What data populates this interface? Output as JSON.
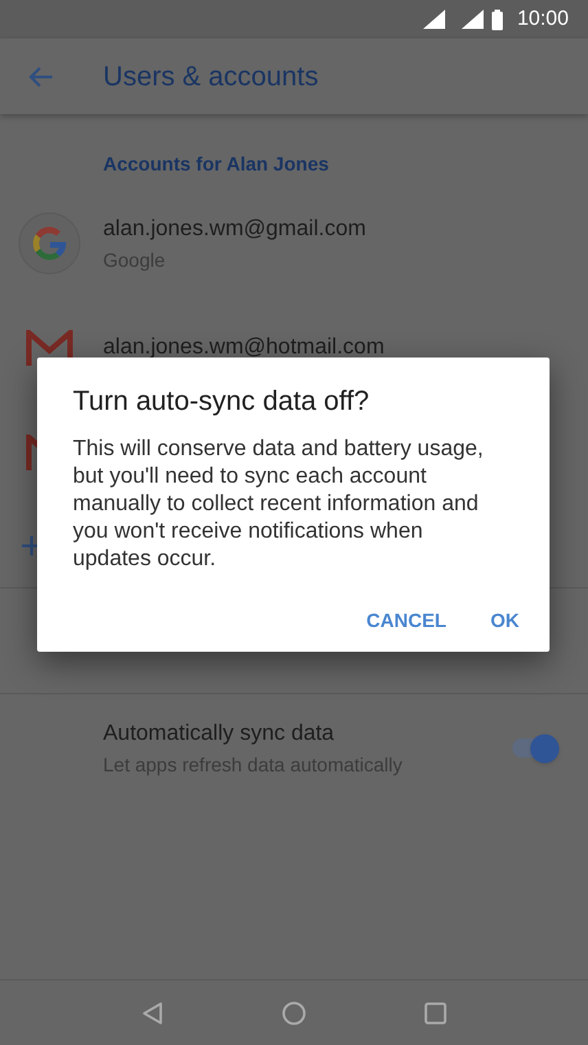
{
  "status_bar": {
    "time": "10:00"
  },
  "app_bar": {
    "title": "Users & accounts"
  },
  "section_header": "Accounts for Alan Jones",
  "accounts": [
    {
      "kind": "google",
      "email": "alan.jones.wm@gmail.com",
      "type": "Google"
    },
    {
      "kind": "mail",
      "email": "alan.jones.wm@hotmail.com"
    },
    {
      "kind": "mail"
    }
  ],
  "settings": [
    {
      "title": "Automatically sync data",
      "subtitle": "Let apps refresh data automatically",
      "on": true
    }
  ],
  "dialog": {
    "title": "Turn auto-sync data off?",
    "message": "This will conserve data and battery usage, but you'll need to sync each account manually to collect recent information and you won't receive notifications when updates occur.",
    "buttons": [
      "CANCEL",
      "OK"
    ]
  }
}
